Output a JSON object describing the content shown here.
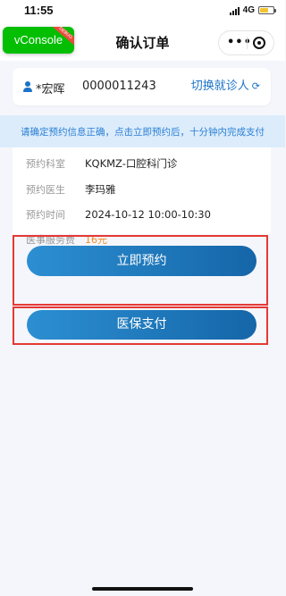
{
  "status_bar": {
    "time": "11:55",
    "network": "4G",
    "battery_level": 0.55,
    "battery_color": "#f4c430"
  },
  "nav": {
    "title": "确认订单",
    "vconsole_label": "vConsole",
    "vconsole_badge": "DEBUG",
    "more_icon": "more-dots-icon",
    "close_icon": "target-circle-icon"
  },
  "patient": {
    "name": "*宏晖",
    "id": "0000011243",
    "switch_label": "切换就诊人",
    "switch_icon": "refresh-icon"
  },
  "notice": {
    "text": "请确定预约信息正确，点击立即预约后，十分钟内完成支付"
  },
  "details": [
    {
      "label": "预约科室",
      "value": "KQKMZ-口腔科门诊"
    },
    {
      "label": "预约医生",
      "value": "李玛雅"
    },
    {
      "label": "预约时间",
      "value": "2024-10-12 10:00-10:30"
    },
    {
      "label": "医事服务费",
      "value": "16元"
    }
  ],
  "actions": {
    "book_label": "立即预约",
    "insurance_pay_label": "医保支付"
  },
  "colors": {
    "accent": "#1a73c8",
    "button_start": "#2c8fd2",
    "button_end": "#1566a8",
    "fee": "#f08a24",
    "highlight_frame": "#e53935",
    "notice_bg": "#dcecfb"
  }
}
